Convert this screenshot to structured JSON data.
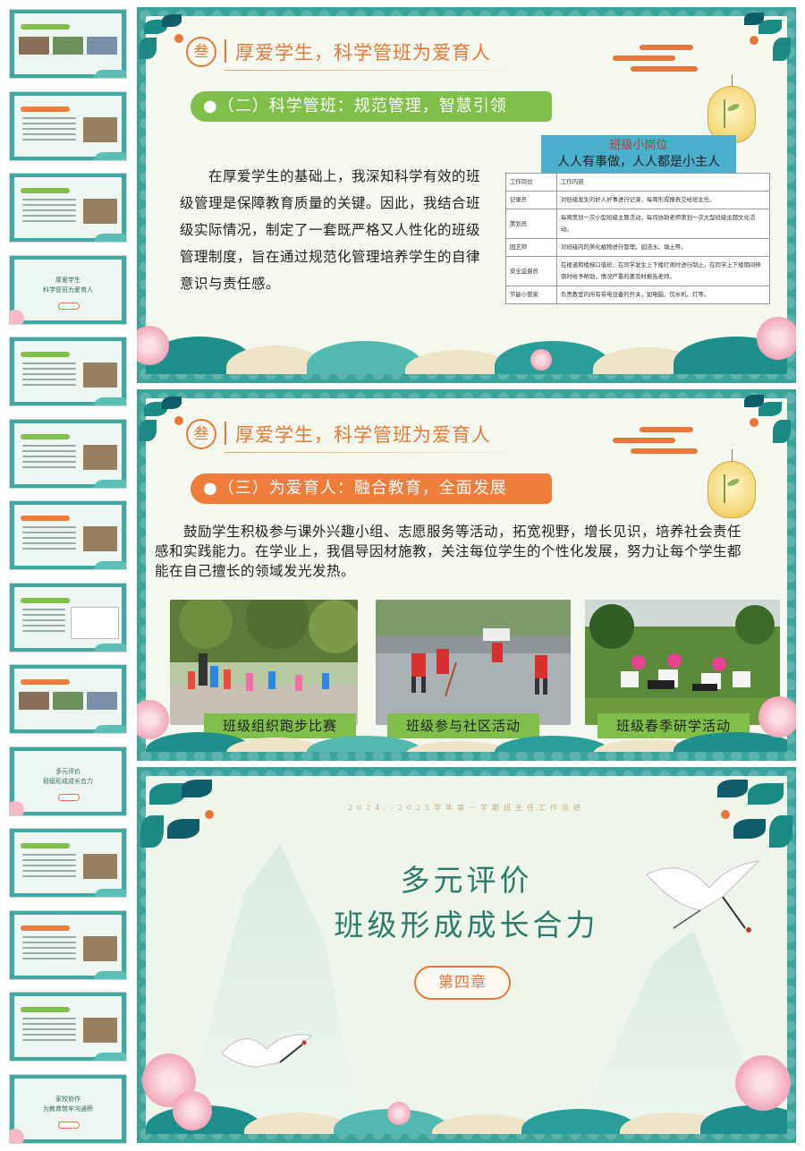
{
  "thumbnails": [
    {
      "title": "",
      "kind": "photos",
      "bar": "#7fbf4a"
    },
    {
      "title": "",
      "kind": "text-photo",
      "bar": "#ee7d3c"
    },
    {
      "title": "",
      "kind": "text-photo",
      "bar": "#7fbf4a"
    },
    {
      "title": "厚爱学生\n科学管班为爱育人",
      "kind": "cover"
    },
    {
      "title": "",
      "kind": "text-photo",
      "bar": "#7fbf4a"
    },
    {
      "title": "",
      "kind": "text-photo",
      "bar": "#7fbf4a"
    },
    {
      "title": "",
      "kind": "text-photo",
      "bar": "#ee7d3c"
    },
    {
      "title": "",
      "kind": "table",
      "bar": "#7fbf4a"
    },
    {
      "title": "",
      "kind": "photos",
      "bar": "#ee7d3c"
    },
    {
      "title": "多元评价\n班级形成成长合力",
      "kind": "cover"
    },
    {
      "title": "",
      "kind": "text-photo",
      "bar": "#7fbf4a"
    },
    {
      "title": "",
      "kind": "text-photo",
      "bar": "#ee7d3c"
    },
    {
      "title": "",
      "kind": "text-photo",
      "bar": "#7fbf4a"
    },
    {
      "title": "家校协作\n为教育筑牢沟通桥",
      "kind": "cover"
    }
  ],
  "slide1": {
    "section_number": "叁",
    "section_title": "厚爱学生，科学管班为爱育人",
    "pill": "●（二）科学管班：规范管理，智慧引领",
    "paragraph": "在厚爱学生的基础上，我深知科学有效的班级管理是保障教育质量的关键。因此，我结合班级实际情况，制定了一套既严格又人性化的班级管理制度，旨在通过规范化管理培养学生的自律意识与责任感。",
    "table_caption_1": "班级小岗位",
    "table_caption_2": "人人有事做，人人都是小主人",
    "table_header": [
      "工作岗位",
      "工作内容"
    ],
    "table_rows": [
      [
        "记录员",
        "对班级发生的好人好事进行记录，每周形成报表交给班主任。"
      ],
      [
        "策划员",
        "每周策划一次小型班级主题活动，每月协助老师策划一次大型班级主题文化活动。"
      ],
      [
        "园艺师",
        "对班级内的美化植物进行管理，如浇水、填土等。"
      ],
      [
        "安全监督员",
        "在楼道和楼梯口值班，在同学发生上下楼打闹时进行制止，在同学上下楼期间伸倒时给予帮助，情况严重的要及时报告老师。"
      ],
      [
        "节能小管家",
        "负责教室内所有带电设备的开关，如电脑、饮水机、灯等。"
      ]
    ]
  },
  "slide2": {
    "section_number": "叁",
    "section_title": "厚爱学生，科学管班为爱育人",
    "pill": "●（三）为爱育人：融合教育，全面发展",
    "paragraph": "鼓励学生积极参与课外兴趣小组、志愿服务等活动，拓宽视野，增长见识，培养社会责任感和实践能力。在学业上，我倡导因材施教，关注每位学生的个性化发展，努力让每个学生都能在自己擅长的领域发光发热。",
    "photos": [
      {
        "caption": "班级组织跑步比赛"
      },
      {
        "caption": "班级参与社区活动"
      },
      {
        "caption": "班级春季研学活动"
      }
    ]
  },
  "slide3": {
    "year_line": "2024--2025学年第一学期班主任工作总结",
    "title_1": "多元评价",
    "title_2": "班级形成成长合力",
    "chapter": "第四章"
  },
  "colors": {
    "frame_teal": "#3aa39b",
    "accent_orange": "#e8773a",
    "pill_green": "#7fbf4a",
    "pill_orange": "#ee7d3c",
    "cover_title_green": "#2b7a6a",
    "background_cream": "#f4f8ee"
  }
}
